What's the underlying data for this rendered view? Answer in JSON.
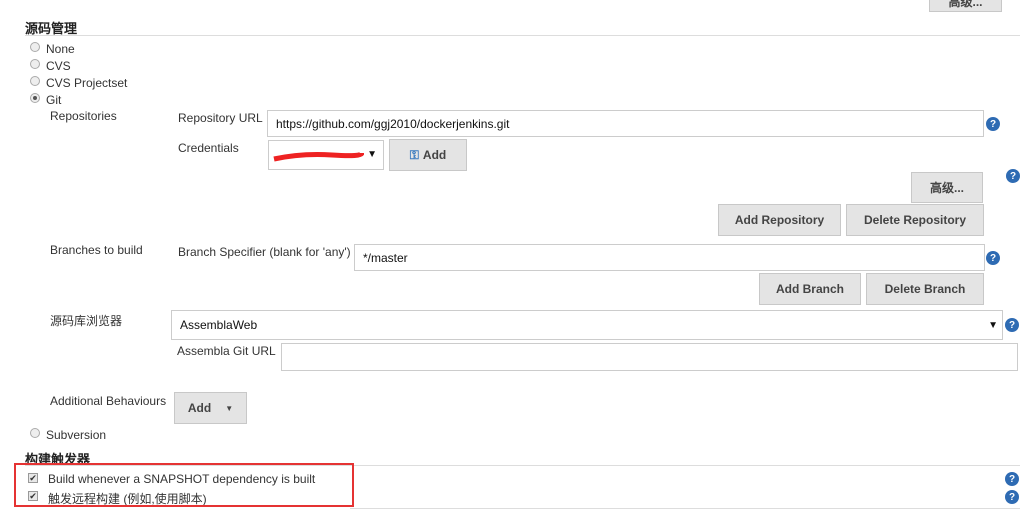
{
  "top_button": "高级...",
  "scm": {
    "title": "源码管理",
    "options": [
      "None",
      "CVS",
      "CVS Projectset",
      "Git"
    ],
    "selected": "Git",
    "subversion": "Subversion"
  },
  "git": {
    "repositories_label": "Repositories",
    "repo_url_label": "Repository URL",
    "repo_url": "https://github.com/ggj2010/dockerjenkins.git",
    "credentials_label": "Credentials",
    "credentials_value": "",
    "add_label": "Add",
    "advanced_label": "高级...",
    "add_repository": "Add Repository",
    "delete_repository": "Delete Repository",
    "branches_label": "Branches to build",
    "branch_specifier_label": "Branch Specifier (blank for 'any')",
    "branch_specifier": "*/master",
    "add_branch": "Add Branch",
    "delete_branch": "Delete Branch",
    "browser_label": "源码库浏览器",
    "browser_value": "AssemblaWeb",
    "assembla_url_label": "Assembla Git URL",
    "assembla_url": "",
    "additional_label": "Additional Behaviours",
    "additional_add": "Add"
  },
  "triggers": {
    "title": "构建触发器",
    "items": [
      {
        "label": "Build whenever a SNAPSHOT dependency is built",
        "checked": true
      },
      {
        "label": "触发远程构建 (例如,使用脚本)",
        "checked": true
      }
    ]
  },
  "help_symbol": "?",
  "highlight_color": "#e53333"
}
